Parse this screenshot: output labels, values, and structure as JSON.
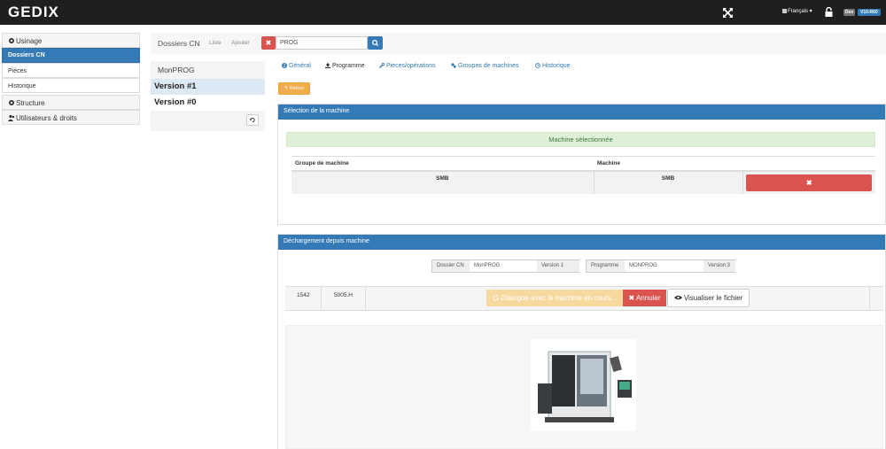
{
  "app": {
    "logo": "GEDIX",
    "language": "Français",
    "env_badge": "Dev",
    "version_badge": "V10-R60"
  },
  "sidebar": {
    "items": [
      {
        "label": "Usinage",
        "icon": "gear-icon"
      },
      {
        "label": "Dossiers CN"
      },
      {
        "label": "Pièces"
      },
      {
        "label": "Historique"
      },
      {
        "label": "Structure",
        "icon": "gear-icon"
      },
      {
        "label": "Utilisateurs & droits",
        "icon": "users-icon"
      }
    ]
  },
  "breadcrumb": {
    "title": "Dossiers CN",
    "list_link": "Liste",
    "add_link": "Ajouter",
    "search_value": "PROG"
  },
  "versions": {
    "program_name": "MonPROG",
    "items": [
      "Version #1",
      "Version #0"
    ]
  },
  "tabs": [
    {
      "label": "Général",
      "icon": "info-icon"
    },
    {
      "label": "Programme",
      "icon": "upload-icon"
    },
    {
      "label": "Pieces/opérations",
      "icon": "wrench-icon"
    },
    {
      "label": "Groupes de machines",
      "icon": "cogs-icon"
    },
    {
      "label": "Historique",
      "icon": "history-icon"
    }
  ],
  "return_label": "Retour",
  "machine_selection": {
    "title": "Sélection de la machine",
    "selected_text": "Machine sélectionnée",
    "columns": [
      "Groupe de machine",
      "Machine"
    ],
    "row": {
      "group": "SMB",
      "machine": "SMB"
    }
  },
  "download": {
    "title": "Déchargement depuis machine",
    "folder_label": "Dossier CN",
    "folder_value": "MonPROG",
    "folder_version": "Version 1",
    "program_label": "Programme",
    "program_value": "MONPROG",
    "program_version": "Version 3",
    "size": "1542",
    "file_name": "5005.H",
    "dialog_message": "Dialogue avec la machine en cours...",
    "cancel_label": "Annuler",
    "view_label": "Visualiser le fichier"
  },
  "colors": {
    "primary": "#337ab7",
    "danger": "#d9534f",
    "warning": "#f0ad4e",
    "success_bg": "#dff0d8",
    "topbar": "#1f1f1f"
  }
}
